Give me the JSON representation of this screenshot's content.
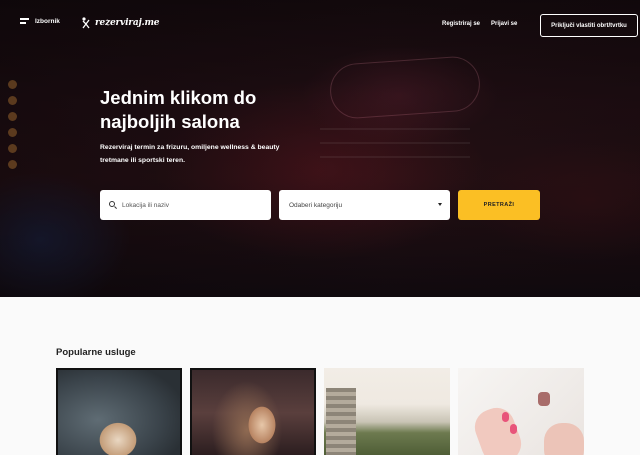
{
  "nav": {
    "menu_label": "Izbornik",
    "logo_text": "rezerviraj.me",
    "register_label": "Registriraj se",
    "login_label": "Prijavi se",
    "cta_label": "Priključi vlastiti obrt/tvrtku"
  },
  "hero": {
    "title": "Jednim klikom do najboljih salona",
    "subtitle": "Rezerviraj termin za frizuru, omiljene wellness & beauty tretmane ili sportski teren."
  },
  "search": {
    "placeholder": "Lokacija ili naziv",
    "category_label": "Odaberi kategoriju",
    "button_label": "PRETRAŽI"
  },
  "popular": {
    "title": "Popularne usluge"
  },
  "colors": {
    "accent": "#fbbf24"
  }
}
